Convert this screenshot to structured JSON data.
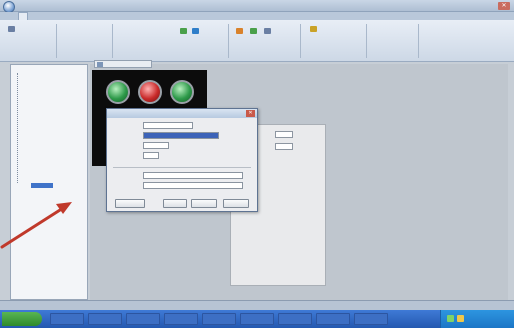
{
  "window": {
    "title": "",
    "close_glyph": "✕"
  },
  "ribbon": {
    "tabs": [
      "",
      "",
      ""
    ],
    "items": [
      "",
      "",
      "",
      "",
      "",
      "",
      "",
      "",
      "",
      "",
      "",
      "",
      "",
      "",
      "",
      ""
    ],
    "icon_colors": [
      "#4aa04a",
      "#2f7ec9",
      "#d9822b",
      "#4aa04a",
      "#6a7fa3",
      "#c9a227"
    ]
  },
  "tree": {
    "items": [
      "",
      "",
      "",
      "",
      "",
      "",
      "",
      "",
      "",
      "",
      "",
      "",
      "",
      "",
      "",
      "",
      "",
      "",
      "",
      ""
    ],
    "selected_index": 19
  },
  "document": {
    "tab_label": ""
  },
  "dialog": {
    "title": "",
    "close_glyph": "✕",
    "fields": [
      {
        "label": "",
        "value": ""
      },
      {
        "label": "",
        "value": ""
      },
      {
        "label": "",
        "value": ""
      },
      {
        "label": "",
        "value": ""
      },
      {
        "label": "",
        "value": ""
      },
      {
        "label": "",
        "value": ""
      }
    ],
    "buttons": [
      "",
      "",
      "",
      ""
    ]
  },
  "statusbar": {
    "left_text": "",
    "right_text": ""
  },
  "taskbar": {
    "start_label": "",
    "tasks": [
      "",
      "",
      "",
      "",
      "",
      "",
      "",
      "",
      ""
    ],
    "clock": ""
  },
  "colors": {
    "annotation_arrow": "#c0392b",
    "lamp_green": "#2e9a4a",
    "lamp_red": "#c92a2a",
    "selection": "#3c63b8"
  },
  "icons": [
    "app-orb-icon",
    "close-icon",
    "lamp-icon",
    "arrow-annotation-icon",
    "start-icon"
  ]
}
